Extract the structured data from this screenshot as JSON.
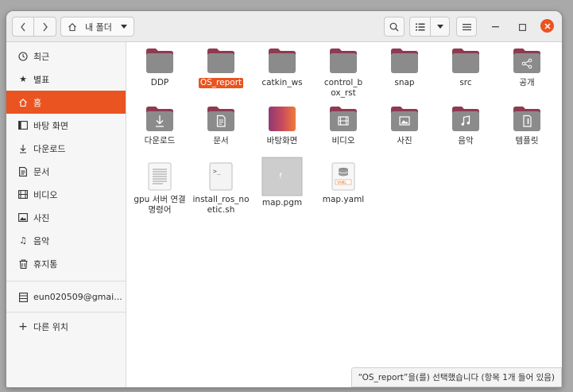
{
  "toolbar": {
    "back_icon": "chevron-left",
    "forward_icon": "chevron-right",
    "location": "내 폴더"
  },
  "sidebar": {
    "items": [
      {
        "label": "최근",
        "icon": "clock-icon"
      },
      {
        "label": "별표",
        "icon": "star-icon"
      },
      {
        "label": "홈",
        "icon": "home-icon",
        "active": true
      },
      {
        "label": "바탕 화면",
        "icon": "desktop-icon"
      },
      {
        "label": "다운로드",
        "icon": "download-icon"
      },
      {
        "label": "문서",
        "icon": "document-icon"
      },
      {
        "label": "비디오",
        "icon": "video-icon"
      },
      {
        "label": "사진",
        "icon": "picture-icon"
      },
      {
        "label": "음악",
        "icon": "music-icon"
      },
      {
        "label": "휴지통",
        "icon": "trash-icon"
      }
    ],
    "account": {
      "label": "eun020509@gmai...",
      "icon": "account-icon"
    },
    "other": {
      "label": "다른 위치",
      "icon": "plus-icon"
    }
  },
  "files": [
    {
      "name": "DDP",
      "type": "folder"
    },
    {
      "name": "OS_report",
      "type": "folder",
      "selected": true
    },
    {
      "name": "catkin_ws",
      "type": "folder"
    },
    {
      "name": "control_box_rst",
      "type": "folder"
    },
    {
      "name": "snap",
      "type": "folder"
    },
    {
      "name": "src",
      "type": "folder"
    },
    {
      "name": "공개",
      "type": "folder-share"
    },
    {
      "name": "다운로드",
      "type": "folder-download"
    },
    {
      "name": "문서",
      "type": "folder-document"
    },
    {
      "name": "바탕화면",
      "type": "folder-desktop"
    },
    {
      "name": "비디오",
      "type": "folder-video"
    },
    {
      "name": "사진",
      "type": "folder-picture"
    },
    {
      "name": "음악",
      "type": "folder-music"
    },
    {
      "name": "템플릿",
      "type": "folder-template"
    },
    {
      "name": "gpu 서버 연결 명령어",
      "type": "text-file"
    },
    {
      "name": "install_ros_noetic.sh",
      "type": "script-file"
    },
    {
      "name": "map.pgm",
      "type": "image-file"
    },
    {
      "name": "map.yaml",
      "type": "yaml-file"
    }
  ],
  "status": "“OS_report”을(를) 선택했습니다 (항목 1개 들어 있음)",
  "colors": {
    "accent": "#e95420",
    "folder": "#8b8b8b",
    "folder_tab": "#8e3a52"
  }
}
